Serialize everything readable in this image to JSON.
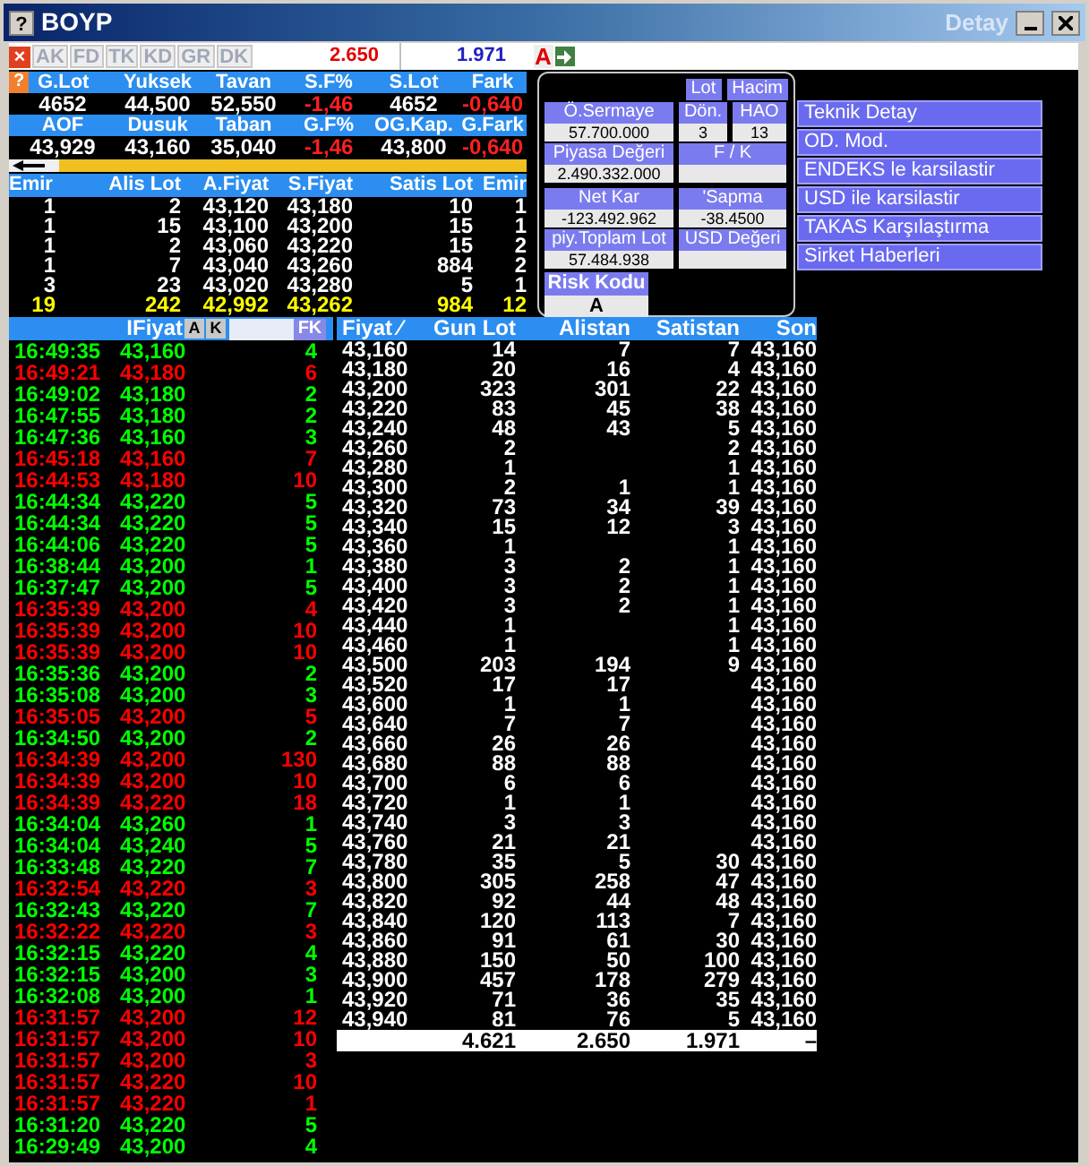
{
  "window": {
    "title": "BOYP",
    "subtitle": "Detay",
    "help": "?"
  },
  "toolbar": {
    "close": "×",
    "tabs": [
      {
        "label": "AK",
        "disabled": true
      },
      {
        "label": "FD",
        "disabled": true
      },
      {
        "label": "TK",
        "disabled": true
      },
      {
        "label": "KD",
        "disabled": true
      },
      {
        "label": "GR",
        "disabled": true
      },
      {
        "label": "DK",
        "disabled": true
      }
    ],
    "sell_total": "2.650",
    "buy_total": "1.971",
    "mode": "A"
  },
  "quote": {
    "help": "?",
    "rows": [
      {
        "headers": [
          "G.Lot",
          "Yuksek",
          "Tavan",
          "S.F%",
          "S.Lot",
          "Fark"
        ],
        "values": [
          {
            "text": "4652",
            "negative": false
          },
          {
            "text": "44,500",
            "negative": false
          },
          {
            "text": "52,550",
            "negative": false
          },
          {
            "text": "-1,46",
            "negative": true
          },
          {
            "text": "4652",
            "negative": false
          },
          {
            "text": "-0,640",
            "negative": true
          }
        ]
      },
      {
        "headers": [
          "AOF",
          "Dusuk",
          "Taban",
          "G.F%",
          "OG.Kap.",
          "G.Fark"
        ],
        "values": [
          {
            "text": "43,929",
            "negative": false
          },
          {
            "text": "43,160",
            "negative": false
          },
          {
            "text": "35,040",
            "negative": false
          },
          {
            "text": "-1,46",
            "negative": true
          },
          {
            "text": "43,800",
            "negative": false
          },
          {
            "text": "-0,640",
            "negative": true
          }
        ]
      }
    ]
  },
  "order_book": {
    "columns": [
      "Emir",
      "Alis Lot",
      "A.Fiyat",
      "S.Fiyat",
      "Satis Lot",
      "Emir"
    ],
    "rows": [
      [
        "1",
        "2",
        "43,120",
        "43,180",
        "10",
        "1"
      ],
      [
        "1",
        "15",
        "43,100",
        "43,200",
        "15",
        "1"
      ],
      [
        "1",
        "2",
        "43,060",
        "43,220",
        "15",
        "2"
      ],
      [
        "1",
        "7",
        "43,040",
        "43,260",
        "884",
        "2"
      ],
      [
        "3",
        "23",
        "43,020",
        "43,280",
        "5",
        "1"
      ]
    ],
    "totals": [
      "19",
      "242",
      "42,992",
      "43,262",
      "984",
      "12"
    ]
  },
  "details": {
    "buttons": [
      "Lot",
      "Hacim"
    ],
    "fields": [
      {
        "label": "Ö.Sermaye",
        "value": "57.700.000"
      },
      {
        "label": "Dön.",
        "value": "3"
      },
      {
        "label": "HAO",
        "value": "13"
      },
      {
        "label": "Piyasa Değeri",
        "value": "2.490.332.000"
      },
      {
        "label": "F / K"
      },
      {
        "label": "Net Kar",
        "value": "-123.492.962"
      },
      {
        "label": "'Sapma",
        "value": "-38.4500"
      },
      {
        "label": "piy.Toplam Lot",
        "value": "57.484.938"
      },
      {
        "label": "USD Değeri"
      }
    ],
    "risk": {
      "label": "Risk Kodu",
      "value": "A"
    }
  },
  "links": [
    "Teknik Detay",
    "OD. Mod.",
    "ENDEKS le karsilastir",
    "USD ile karsilastir",
    "TAKAS Karşılaştırma",
    "Sirket Haberleri"
  ],
  "trades": {
    "header": "IFiyat",
    "buttons": [
      "A",
      "K"
    ],
    "fk": "FK",
    "rows": [
      {
        "time": "16:49:35",
        "price": "43,160",
        "lot": "4",
        "rising": true
      },
      {
        "time": "16:49:21",
        "price": "43,180",
        "lot": "6",
        "rising": false
      },
      {
        "time": "16:49:02",
        "price": "43,180",
        "lot": "2",
        "rising": true
      },
      {
        "time": "16:47:55",
        "price": "43,180",
        "lot": "2",
        "rising": true
      },
      {
        "time": "16:47:36",
        "price": "43,160",
        "lot": "3",
        "rising": true
      },
      {
        "time": "16:45:18",
        "price": "43,160",
        "lot": "7",
        "rising": false
      },
      {
        "time": "16:44:53",
        "price": "43,180",
        "lot": "10",
        "rising": false
      },
      {
        "time": "16:44:34",
        "price": "43,220",
        "lot": "5",
        "rising": true
      },
      {
        "time": "16:44:34",
        "price": "43,220",
        "lot": "5",
        "rising": true
      },
      {
        "time": "16:44:06",
        "price": "43,220",
        "lot": "5",
        "rising": true
      },
      {
        "time": "16:38:44",
        "price": "43,200",
        "lot": "1",
        "rising": true
      },
      {
        "time": "16:37:47",
        "price": "43,200",
        "lot": "5",
        "rising": true
      },
      {
        "time": "16:35:39",
        "price": "43,200",
        "lot": "4",
        "rising": false
      },
      {
        "time": "16:35:39",
        "price": "43,200",
        "lot": "10",
        "rising": false
      },
      {
        "time": "16:35:39",
        "price": "43,200",
        "lot": "10",
        "rising": false
      },
      {
        "time": "16:35:36",
        "price": "43,200",
        "lot": "2",
        "rising": true
      },
      {
        "time": "16:35:08",
        "price": "43,200",
        "lot": "3",
        "rising": true
      },
      {
        "time": "16:35:05",
        "price": "43,200",
        "lot": "5",
        "rising": false
      },
      {
        "time": "16:34:50",
        "price": "43,200",
        "lot": "2",
        "rising": true
      },
      {
        "time": "16:34:39",
        "price": "43,200",
        "lot": "130",
        "rising": false
      },
      {
        "time": "16:34:39",
        "price": "43,200",
        "lot": "10",
        "rising": false
      },
      {
        "time": "16:34:39",
        "price": "43,220",
        "lot": "18",
        "rising": false
      },
      {
        "time": "16:34:04",
        "price": "43,260",
        "lot": "1",
        "rising": true
      },
      {
        "time": "16:34:04",
        "price": "43,240",
        "lot": "5",
        "rising": true
      },
      {
        "time": "16:33:48",
        "price": "43,220",
        "lot": "7",
        "rising": true
      },
      {
        "time": "16:32:54",
        "price": "43,220",
        "lot": "3",
        "rising": false
      },
      {
        "time": "16:32:43",
        "price": "43,220",
        "lot": "7",
        "rising": true
      },
      {
        "time": "16:32:22",
        "price": "43,220",
        "lot": "3",
        "rising": false
      },
      {
        "time": "16:32:15",
        "price": "43,220",
        "lot": "4",
        "rising": true
      },
      {
        "time": "16:32:15",
        "price": "43,200",
        "lot": "3",
        "rising": true
      },
      {
        "time": "16:32:08",
        "price": "43,200",
        "lot": "1",
        "rising": true
      },
      {
        "time": "16:31:57",
        "price": "43,200",
        "lot": "12",
        "rising": false
      },
      {
        "time": "16:31:57",
        "price": "43,200",
        "lot": "10",
        "rising": false
      },
      {
        "time": "16:31:57",
        "price": "43,200",
        "lot": "3",
        "rising": false
      },
      {
        "time": "16:31:57",
        "price": "43,220",
        "lot": "10",
        "rising": false
      },
      {
        "time": "16:31:57",
        "price": "43,220",
        "lot": "1",
        "rising": false
      },
      {
        "time": "16:31:20",
        "price": "43,220",
        "lot": "5",
        "rising": true
      },
      {
        "time": "16:29:49",
        "price": "43,200",
        "lot": "4",
        "rising": true
      }
    ]
  },
  "price_table": {
    "columns": [
      "Fiyat",
      "Gun Lot",
      "Alistan",
      "Satistan",
      "Son"
    ],
    "sort_mark": "⁄",
    "rows": [
      [
        "43,160",
        "14",
        "7",
        "7",
        "43,160"
      ],
      [
        "43,180",
        "20",
        "16",
        "4",
        "43,160"
      ],
      [
        "43,200",
        "323",
        "301",
        "22",
        "43,160"
      ],
      [
        "43,220",
        "83",
        "45",
        "38",
        "43,160"
      ],
      [
        "43,240",
        "48",
        "43",
        "5",
        "43,160"
      ],
      [
        "43,260",
        "2",
        null,
        "2",
        "43,160"
      ],
      [
        "43,280",
        "1",
        null,
        "1",
        "43,160"
      ],
      [
        "43,300",
        "2",
        "1",
        "1",
        "43,160"
      ],
      [
        "43,320",
        "73",
        "34",
        "39",
        "43,160"
      ],
      [
        "43,340",
        "15",
        "12",
        "3",
        "43,160"
      ],
      [
        "43,360",
        "1",
        null,
        "1",
        "43,160"
      ],
      [
        "43,380",
        "3",
        "2",
        "1",
        "43,160"
      ],
      [
        "43,400",
        "3",
        "2",
        "1",
        "43,160"
      ],
      [
        "43,420",
        "3",
        "2",
        "1",
        "43,160"
      ],
      [
        "43,440",
        "1",
        null,
        "1",
        "43,160"
      ],
      [
        "43,460",
        "1",
        null,
        "1",
        "43,160"
      ],
      [
        "43,500",
        "203",
        "194",
        "9",
        "43,160"
      ],
      [
        "43,520",
        "17",
        "17",
        null,
        "43,160"
      ],
      [
        "43,600",
        "1",
        "1",
        null,
        "43,160"
      ],
      [
        "43,640",
        "7",
        "7",
        null,
        "43,160"
      ],
      [
        "43,660",
        "26",
        "26",
        null,
        "43,160"
      ],
      [
        "43,680",
        "88",
        "88",
        null,
        "43,160"
      ],
      [
        "43,700",
        "6",
        "6",
        null,
        "43,160"
      ],
      [
        "43,720",
        "1",
        "1",
        null,
        "43,160"
      ],
      [
        "43,740",
        "3",
        "3",
        null,
        "43,160"
      ],
      [
        "43,760",
        "21",
        "21",
        null,
        "43,160"
      ],
      [
        "43,780",
        "35",
        "5",
        "30",
        "43,160"
      ],
      [
        "43,800",
        "305",
        "258",
        "47",
        "43,160"
      ],
      [
        "43,820",
        "92",
        "44",
        "48",
        "43,160"
      ],
      [
        "43,840",
        "120",
        "113",
        "7",
        "43,160"
      ],
      [
        "43,860",
        "91",
        "61",
        "30",
        "43,160"
      ],
      [
        "43,880",
        "150",
        "50",
        "100",
        "43,160"
      ],
      [
        "43,900",
        "457",
        "178",
        "279",
        "43,160"
      ],
      [
        "43,920",
        "71",
        "36",
        "35",
        "43,160"
      ],
      [
        "43,940",
        "81",
        "76",
        "5",
        "43,160"
      ]
    ],
    "totals": [
      "4.621",
      "2.650",
      "1.971",
      "–"
    ]
  }
}
